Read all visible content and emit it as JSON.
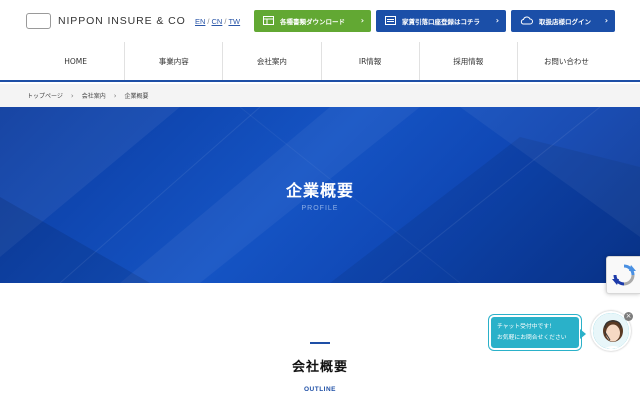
{
  "header": {
    "logo_text": "NIPPON INSURE & CO",
    "languages": [
      "EN",
      "CN",
      "TW"
    ],
    "buttons": [
      {
        "label": "各種書類ダウンロード",
        "icon": "document-download-icon",
        "color": "#62a833"
      },
      {
        "label": "家賃引落口座登録はコチラ",
        "icon": "card-icon",
        "color": "#1b4fa8"
      },
      {
        "label": "取扱店様ログイン",
        "icon": "cloud-icon",
        "color": "#1b4fa8"
      }
    ]
  },
  "nav": {
    "items": [
      "HOME",
      "事業内容",
      "会社案内",
      "IR情報",
      "採用情報",
      "お問い合わせ"
    ]
  },
  "breadcrumb": [
    "トップページ",
    "会社案内",
    "企業概要"
  ],
  "hero": {
    "title": "企業概要",
    "subtitle": "PROFILE"
  },
  "section": {
    "title": "会社概要",
    "subtitle": "OUTLINE"
  },
  "chat": {
    "line1": "チャット受付中です！",
    "line2": "お気軽にお問合せください"
  },
  "colors": {
    "accent": "#1e4fa6",
    "green": "#62a833",
    "chat": "#2ab1c9"
  }
}
